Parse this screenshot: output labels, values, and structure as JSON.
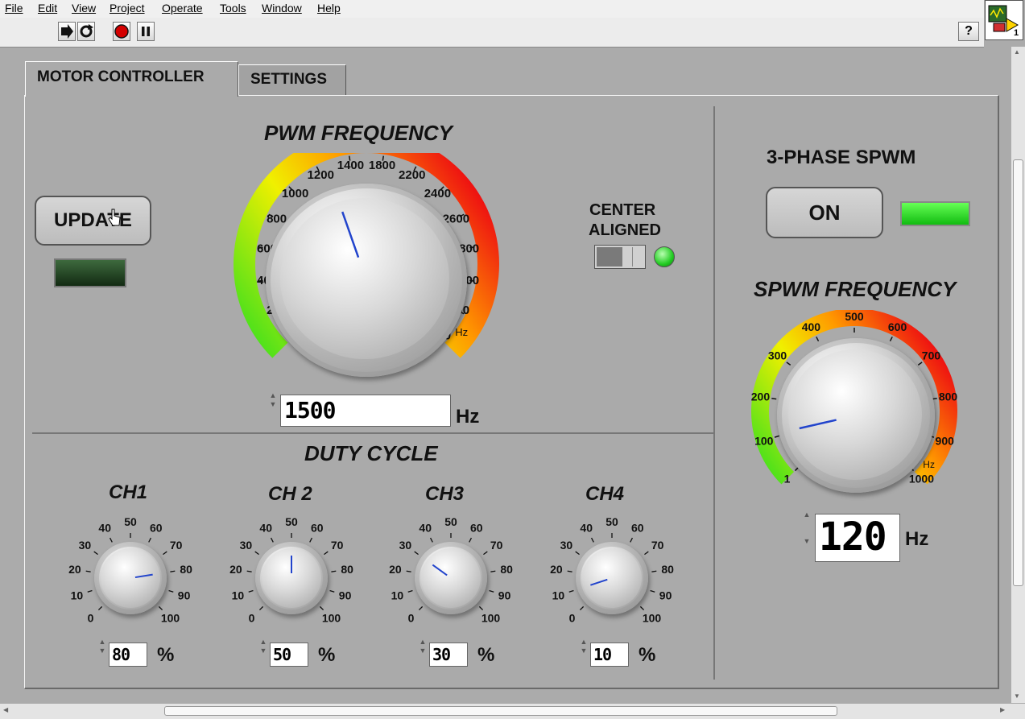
{
  "menu": [
    "File",
    "Edit",
    "View",
    "Project",
    "Operate",
    "Tools",
    "Window",
    "Help"
  ],
  "toolbar": {
    "icons": [
      "run-arrow-icon",
      "run-continuously-icon",
      "abort-stop-icon",
      "pause-icon"
    ],
    "help_label": "?"
  },
  "vi_icon": {
    "number": "1"
  },
  "tabs": [
    "MOTOR CONTROLLER",
    "SETTINGS"
  ],
  "pwm": {
    "title": "PWM FREQUENCY",
    "scale_labels": [
      "1",
      "200",
      "400",
      "600",
      "800",
      "1000",
      "1200",
      "1400",
      "1800",
      "2200",
      "2400",
      "2600",
      "2800",
      "3000",
      "3200",
      "3500"
    ],
    "unit_small": "Hz",
    "value": "1500",
    "unit": "Hz",
    "knob_value": 1500
  },
  "update": {
    "label": "UPDATE",
    "led_on": false
  },
  "center_aligned": {
    "line1": "CENTER",
    "line2": "ALIGNED",
    "led_on": true
  },
  "duty": {
    "title": "DUTY CYCLE",
    "scale_labels": [
      "0",
      "10",
      "20",
      "30",
      "40",
      "50",
      "60",
      "70",
      "80",
      "90",
      "100"
    ],
    "percent": "%",
    "channels": [
      {
        "name": "CH1",
        "value": "80"
      },
      {
        "name": "CH 2",
        "value": "50"
      },
      {
        "name": "CH3",
        "value": "30"
      },
      {
        "name": "CH4",
        "value": "10"
      }
    ]
  },
  "spwm": {
    "title": "3-PHASE SPWM",
    "button": "ON",
    "led_on": true,
    "freq_title": "SPWM FREQUENCY",
    "scale_labels": [
      "1",
      "100",
      "200",
      "300",
      "400",
      "500",
      "600",
      "700",
      "800",
      "900",
      "1000"
    ],
    "unit_small": "Hz",
    "value": "120",
    "unit": "Hz",
    "knob_value": 120
  },
  "colors": {
    "panel": "#aaaaaa",
    "led_green": "#22dd22",
    "led_dark": "#1f3a1f",
    "needle": "#2244cc"
  }
}
